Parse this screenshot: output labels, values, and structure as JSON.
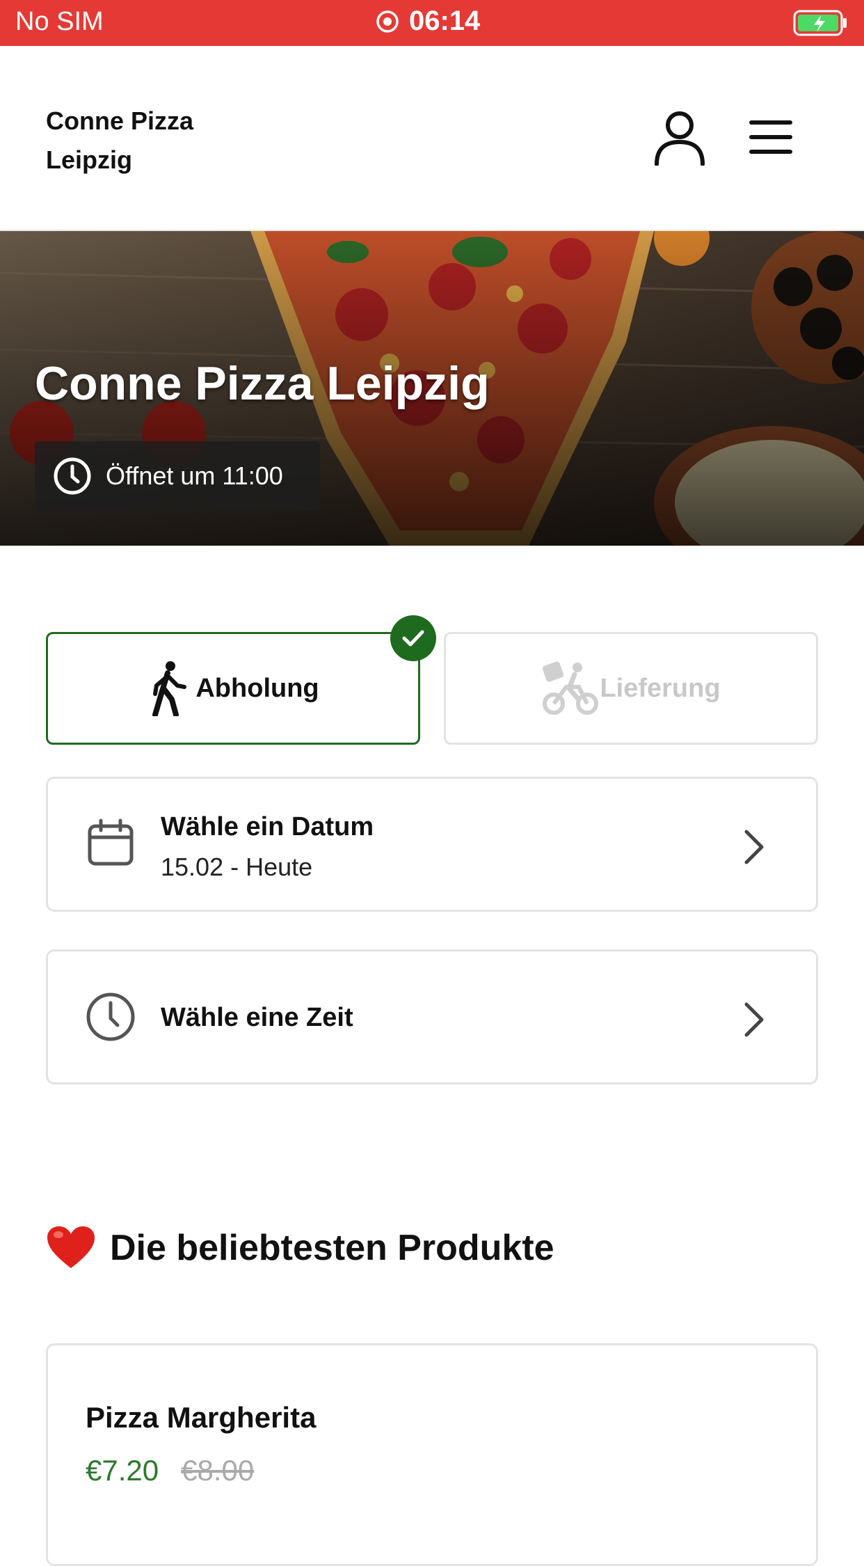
{
  "status_bar": {
    "carrier": "No SIM",
    "time": "06:14",
    "bg_color": "#e53935"
  },
  "header": {
    "brand": "Conne Pizza Leipzig",
    "icons": [
      "user-icon",
      "hamburger-menu-icon"
    ]
  },
  "hero": {
    "title": "Conne Pizza Leipzig",
    "opening_text": "Öffnet um 11:00"
  },
  "order_mode": {
    "pickup_label": "Abholung",
    "delivery_label": "Lieferung",
    "selected": "Abholung",
    "accent_color": "#1e6a1e"
  },
  "date_selector": {
    "title": "Wähle ein Datum",
    "value": "15.02 - Heute"
  },
  "time_selector": {
    "title": "Wähle eine Zeit"
  },
  "popular": {
    "title": "Die beliebtesten Produkte",
    "products": [
      {
        "name": "Pizza Margherita",
        "price": "€7.20",
        "old_price": "€8.00"
      }
    ]
  }
}
